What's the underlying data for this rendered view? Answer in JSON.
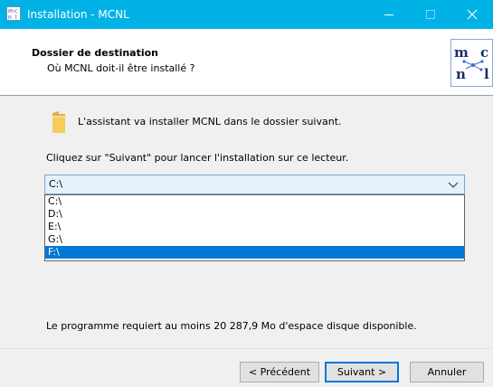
{
  "window": {
    "title": "Installation - MCNL",
    "colors": {
      "titlebar": "#00b2e5",
      "selection": "#0078d7"
    }
  },
  "header": {
    "title": "Dossier de destination",
    "subtitle": "Où MCNL doit-il être installé ?",
    "logo_text": "m c n l"
  },
  "body": {
    "folder_line": "L'assistant va installer MCNL dans le dossier suivant.",
    "instruction": "Cliquez sur \"Suivant\" pour lancer l'installation sur ce lecteur.",
    "drive_select": {
      "value": "C:\\",
      "options": [
        "C:\\",
        "D:\\",
        "E:\\",
        "G:\\",
        "F:\\"
      ],
      "highlighted": "F:\\"
    },
    "space_text": "Le programme requiert au moins 20 287,9 Mo d'espace disque disponible."
  },
  "buttons": {
    "prev": "< Précédent",
    "next": "Suivant >",
    "cancel": "Annuler"
  },
  "icons": [
    "app-icon",
    "minimize-icon",
    "maximize-icon",
    "close-icon",
    "folder-icon",
    "chevron-down-icon",
    "mcnl-logo"
  ]
}
